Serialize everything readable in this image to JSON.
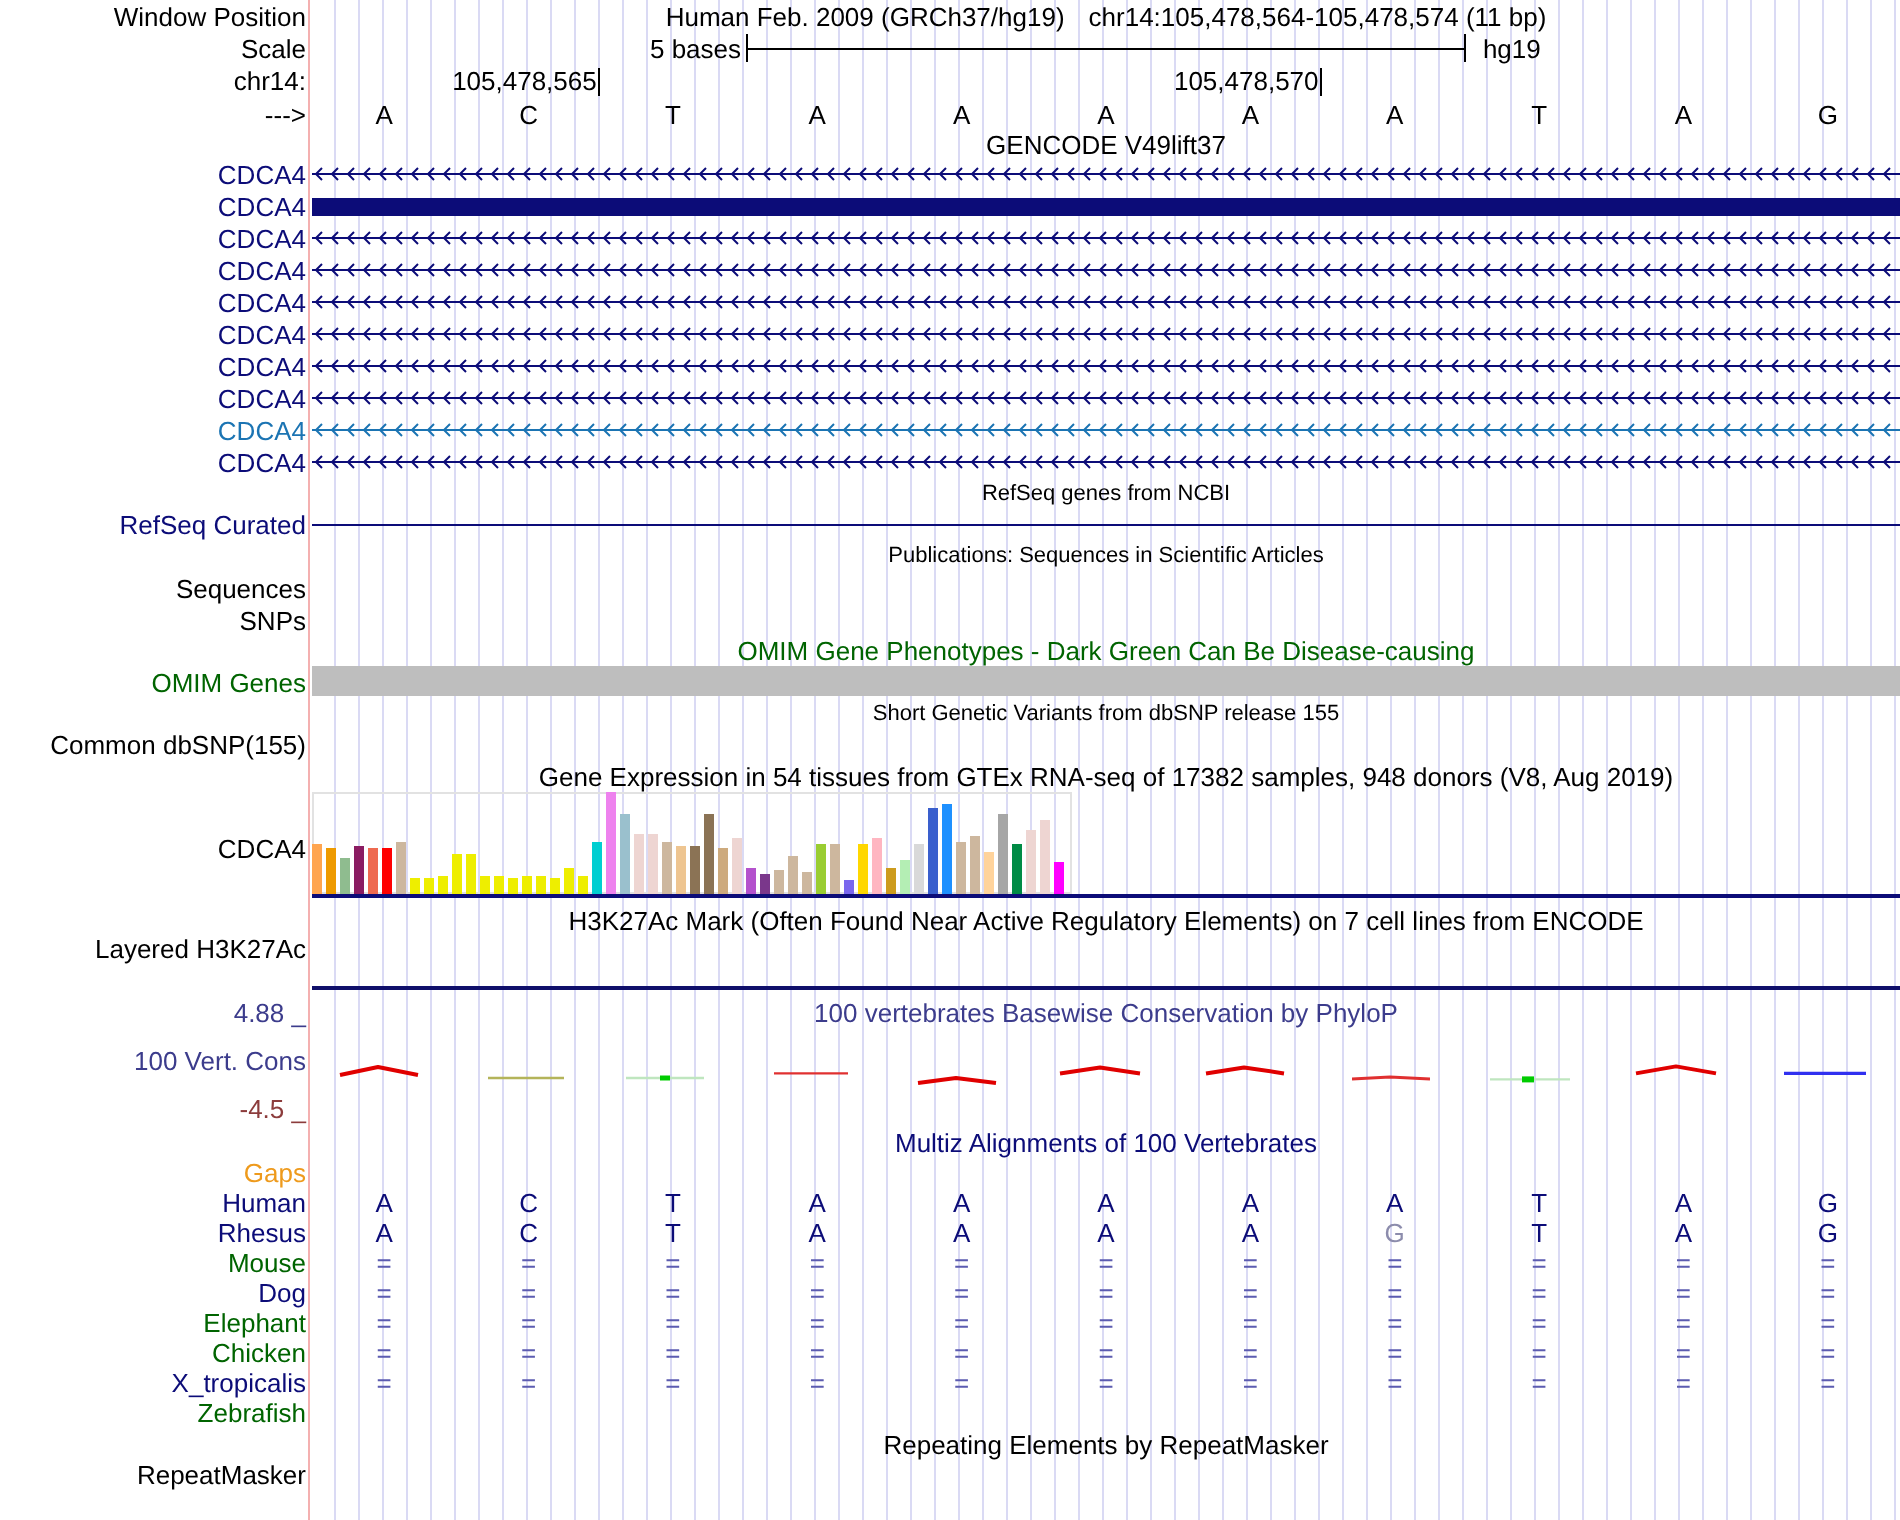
{
  "window_position": {
    "label": "Window Position",
    "assembly": "Human Feb. 2009 (GRCh37/hg19)",
    "position": "chr14:105,478,564-105,478,574 (11 bp)"
  },
  "scale": {
    "label": "Scale",
    "span": "5 bases",
    "assembly": "hg19"
  },
  "ruler": {
    "label": "chr14:",
    "ticks": [
      "105,478,565",
      "105,478,570"
    ]
  },
  "sequence": {
    "label": "--->",
    "bases": [
      "A",
      "C",
      "T",
      "A",
      "A",
      "A",
      "A",
      "A",
      "T",
      "A",
      "G"
    ]
  },
  "gencode": {
    "title": "GENCODE V49lift37",
    "transcripts": [
      {
        "name": "CDCA4",
        "color": "#0c0c78",
        "kind": "intron"
      },
      {
        "name": "CDCA4",
        "color": "#0c0c78",
        "kind": "exon"
      },
      {
        "name": "CDCA4",
        "color": "#0c0c78",
        "kind": "intron"
      },
      {
        "name": "CDCA4",
        "color": "#0c0c78",
        "kind": "intron"
      },
      {
        "name": "CDCA4",
        "color": "#0c0c78",
        "kind": "intron"
      },
      {
        "name": "CDCA4",
        "color": "#0c0c78",
        "kind": "intron"
      },
      {
        "name": "CDCA4",
        "color": "#0c0c78",
        "kind": "intron"
      },
      {
        "name": "CDCA4",
        "color": "#0c0c78",
        "kind": "intron"
      },
      {
        "name": "CDCA4",
        "color": "#1b74b3",
        "kind": "intron"
      },
      {
        "name": "CDCA4",
        "color": "#0c0c78",
        "kind": "intron"
      }
    ]
  },
  "refseq": {
    "title": "RefSeq genes from NCBI",
    "label": "RefSeq Curated"
  },
  "publications": {
    "title": "Publications: Sequences in Scientific Articles",
    "subtracks": [
      "Sequences",
      "SNPs"
    ]
  },
  "omim": {
    "title": "OMIM Gene Phenotypes - Dark Green Can Be Disease-causing",
    "label": "OMIM Genes"
  },
  "dbsnp": {
    "title": "Short Genetic Variants from dbSNP release 155",
    "label": "Common dbSNP(155)"
  },
  "gtex": {
    "title": "Gene Expression in 54 tissues from GTEx RNA-seq of 17382 samples, 948 donors (V8, Aug 2019)",
    "label": "CDCA4"
  },
  "h3k27ac": {
    "title": "H3K27Ac Mark (Often Found Near Active Regulatory Elements) on 7 cell lines from ENCODE",
    "label": "Layered H3K27Ac"
  },
  "conservation": {
    "title": "100 vertebrates Basewise Conservation by PhyloP",
    "label": "100 Vert. Cons",
    "max_label": "4.88 _",
    "min_label": "-4.5 _"
  },
  "multiz": {
    "title": "Multiz Alignments of 100 Vertebrates",
    "gaps_label": "Gaps",
    "species": [
      {
        "name": "Human",
        "color": "#0c0c78",
        "bases": [
          {
            "text": "A",
            "kind": "base"
          },
          {
            "text": "C",
            "kind": "base"
          },
          {
            "text": "T",
            "kind": "base"
          },
          {
            "text": "A",
            "kind": "base"
          },
          {
            "text": "A",
            "kind": "base"
          },
          {
            "text": "A",
            "kind": "base"
          },
          {
            "text": "A",
            "kind": "base"
          },
          {
            "text": "A",
            "kind": "base"
          },
          {
            "text": "T",
            "kind": "base"
          },
          {
            "text": "A",
            "kind": "base"
          },
          {
            "text": "G",
            "kind": "base"
          }
        ]
      },
      {
        "name": "Rhesus",
        "color": "#0c0c78",
        "bases": [
          {
            "text": "A",
            "kind": "base"
          },
          {
            "text": "C",
            "kind": "base"
          },
          {
            "text": "T",
            "kind": "base"
          },
          {
            "text": "A",
            "kind": "base"
          },
          {
            "text": "A",
            "kind": "base"
          },
          {
            "text": "A",
            "kind": "base"
          },
          {
            "text": "A",
            "kind": "base"
          },
          {
            "text": "G",
            "kind": "faint"
          },
          {
            "text": "T",
            "kind": "base"
          },
          {
            "text": "A",
            "kind": "base"
          },
          {
            "text": "G",
            "kind": "base"
          }
        ]
      },
      {
        "name": "Mouse",
        "color": "#006400",
        "bases": [
          {
            "text": "=",
            "kind": "equals"
          },
          {
            "text": "=",
            "kind": "equals"
          },
          {
            "text": "=",
            "kind": "equals"
          },
          {
            "text": "=",
            "kind": "equals"
          },
          {
            "text": "=",
            "kind": "equals"
          },
          {
            "text": "=",
            "kind": "equals"
          },
          {
            "text": "=",
            "kind": "equals"
          },
          {
            "text": "=",
            "kind": "equals"
          },
          {
            "text": "=",
            "kind": "equals"
          },
          {
            "text": "=",
            "kind": "equals"
          },
          {
            "text": "=",
            "kind": "equals"
          }
        ]
      },
      {
        "name": "Dog",
        "color": "#0c0c78",
        "bases": [
          {
            "text": "=",
            "kind": "equals"
          },
          {
            "text": "=",
            "kind": "equals"
          },
          {
            "text": "=",
            "kind": "equals"
          },
          {
            "text": "=",
            "kind": "equals"
          },
          {
            "text": "=",
            "kind": "equals"
          },
          {
            "text": "=",
            "kind": "equals"
          },
          {
            "text": "=",
            "kind": "equals"
          },
          {
            "text": "=",
            "kind": "equals"
          },
          {
            "text": "=",
            "kind": "equals"
          },
          {
            "text": "=",
            "kind": "equals"
          },
          {
            "text": "=",
            "kind": "equals"
          }
        ]
      },
      {
        "name": "Elephant",
        "color": "#006400",
        "bases": [
          {
            "text": "=",
            "kind": "equals"
          },
          {
            "text": "=",
            "kind": "equals"
          },
          {
            "text": "=",
            "kind": "equals"
          },
          {
            "text": "=",
            "kind": "equals"
          },
          {
            "text": "=",
            "kind": "equals"
          },
          {
            "text": "=",
            "kind": "equals"
          },
          {
            "text": "=",
            "kind": "equals"
          },
          {
            "text": "=",
            "kind": "equals"
          },
          {
            "text": "=",
            "kind": "equals"
          },
          {
            "text": "=",
            "kind": "equals"
          },
          {
            "text": "=",
            "kind": "equals"
          }
        ]
      },
      {
        "name": "Chicken",
        "color": "#006400",
        "bases": [
          {
            "text": "=",
            "kind": "equals"
          },
          {
            "text": "=",
            "kind": "equals"
          },
          {
            "text": "=",
            "kind": "equals"
          },
          {
            "text": "=",
            "kind": "equals"
          },
          {
            "text": "=",
            "kind": "equals"
          },
          {
            "text": "=",
            "kind": "equals"
          },
          {
            "text": "=",
            "kind": "equals"
          },
          {
            "text": "=",
            "kind": "equals"
          },
          {
            "text": "=",
            "kind": "equals"
          },
          {
            "text": "=",
            "kind": "equals"
          },
          {
            "text": "=",
            "kind": "equals"
          }
        ]
      },
      {
        "name": "X_tropicalis",
        "color": "#0c0c78",
        "bases": [
          {
            "text": "=",
            "kind": "equals"
          },
          {
            "text": "=",
            "kind": "equals"
          },
          {
            "text": "=",
            "kind": "equals"
          },
          {
            "text": "=",
            "kind": "equals"
          },
          {
            "text": "=",
            "kind": "equals"
          },
          {
            "text": "=",
            "kind": "equals"
          },
          {
            "text": "=",
            "kind": "equals"
          },
          {
            "text": "=",
            "kind": "equals"
          },
          {
            "text": "=",
            "kind": "equals"
          },
          {
            "text": "=",
            "kind": "equals"
          },
          {
            "text": "=",
            "kind": "equals"
          }
        ]
      },
      {
        "name": "Zebrafish",
        "color": "#006400"
      }
    ]
  },
  "repeatmasker": {
    "title": "Repeating Elements by RepeatMasker",
    "label": "RepeatMasker"
  }
}
